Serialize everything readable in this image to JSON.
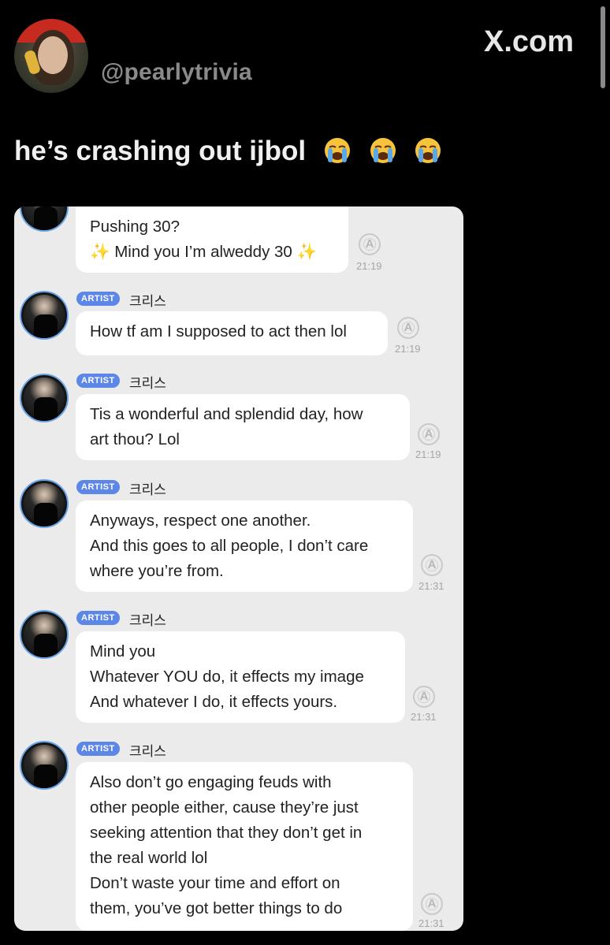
{
  "post": {
    "handle": "@pearlytrivia",
    "site": "X.com",
    "text": "he’s crashing out ijbol",
    "emojis": [
      "loudly-crying-face",
      "loudly-crying-face",
      "loudly-crying-face"
    ]
  },
  "chat": {
    "artist_badge": "ARTIST",
    "sender_name": "크리스",
    "timestamp_icon": "A",
    "messages": [
      {
        "lines": [
          "Pushing 30?",
          "✨ Mind you I’m alweddy 30 ✨"
        ],
        "time": "21:19",
        "show_header": false
      },
      {
        "lines": [
          "How tf am I supposed to act then lol"
        ],
        "time": "21:19",
        "show_header": true
      },
      {
        "lines": [
          "Tis a wonderful and splendid day, how",
          "art thou? Lol"
        ],
        "time": "21:19",
        "show_header": true
      },
      {
        "lines": [
          "Anyways, respect one another.",
          "And this goes to all people, I don’t care",
          "where you’re from."
        ],
        "time": "21:31",
        "show_header": true
      },
      {
        "lines": [
          "Mind you",
          "Whatever YOU do, it effects my image",
          "And whatever I do, it effects yours."
        ],
        "time": "21:31",
        "show_header": true
      },
      {
        "lines": [
          "Also don’t go engaging feuds with",
          "other people either, cause they’re just",
          "seeking attention that they don’t get in",
          "the real world lol",
          "Don’t waste your time and effort on",
          "them, you’ve got better things to do"
        ],
        "time": "21:31",
        "show_header": true
      }
    ]
  }
}
